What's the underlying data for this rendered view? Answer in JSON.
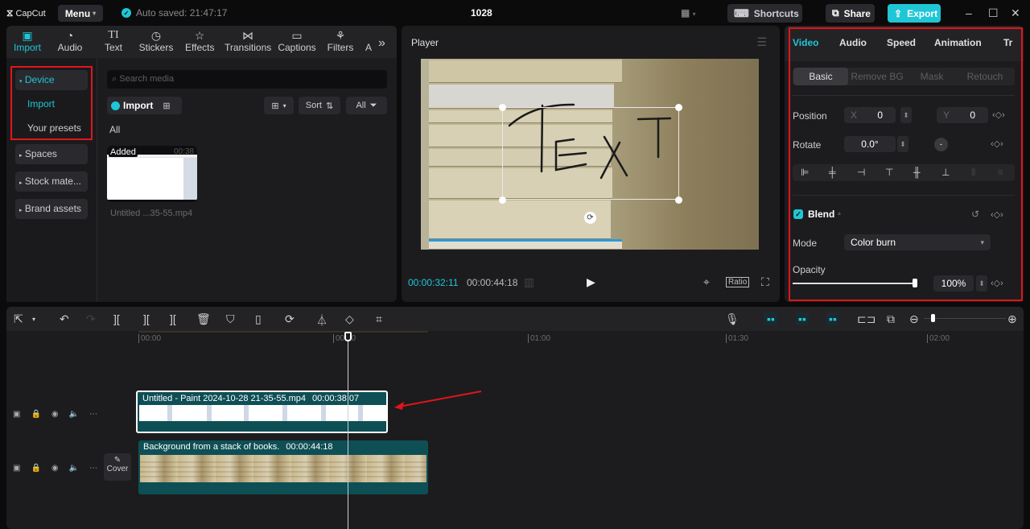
{
  "titlebar": {
    "app_name": "CapCut",
    "menu_label": "Menu",
    "autosave_text": "Auto saved: 21:47:17",
    "project_title": "1028",
    "shortcuts_label": "Shortcuts",
    "share_label": "Share",
    "export_label": "Export",
    "accent_color": "#1fc6d6"
  },
  "media_panel": {
    "tabs": [
      {
        "label": "Import",
        "icon": "import-icon",
        "active": true
      },
      {
        "label": "Audio",
        "icon": "audio-icon"
      },
      {
        "label": "Text",
        "icon": "text-icon"
      },
      {
        "label": "Stickers",
        "icon": "sticker-icon"
      },
      {
        "label": "Effects",
        "icon": "effects-icon"
      },
      {
        "label": "Transitions",
        "icon": "transitions-icon"
      },
      {
        "label": "Captions",
        "icon": "captions-icon"
      },
      {
        "label": "Filters",
        "icon": "filters-icon"
      },
      {
        "label": "A",
        "icon": ""
      }
    ],
    "sidebar": {
      "device": "Device",
      "import": "Import",
      "presets": "Your presets",
      "spaces": "Spaces",
      "stock": "Stock mate...",
      "brand": "Brand assets"
    },
    "search_placeholder": "Search media",
    "import_button": "Import",
    "sort_label": "Sort",
    "filter_label": "All",
    "section_label": "All",
    "items": [
      {
        "badge": "Added",
        "duration": "00:38",
        "name": "Untitled ...35-55.mp4"
      }
    ]
  },
  "player": {
    "title": "Player",
    "current_time": "00:00:32:11",
    "total_time": "00:00:44:18",
    "ratio_label": "Ratio",
    "overlay_text": "TEXT"
  },
  "properties": {
    "tabs": [
      "Video",
      "Audio",
      "Speed",
      "Animation",
      "Tr"
    ],
    "subtabs": [
      "Basic",
      "Remove BG",
      "Mask",
      "Retouch"
    ],
    "position_label": "Position",
    "x_label": "X",
    "x_value": "0",
    "y_label": "Y",
    "y_value": "0",
    "rotate_label": "Rotate",
    "rotate_value": "0.0°",
    "blend_label": "Blend",
    "blend_enabled": true,
    "mode_label": "Mode",
    "mode_value": "Color burn",
    "opacity_label": "Opacity",
    "opacity_value": "100%",
    "opacity_fraction": 1.0
  },
  "timeline": {
    "ruler": [
      "00:00",
      "00:30",
      "01:00",
      "01:30",
      "02:00"
    ],
    "cover_label": "Cover",
    "clips": [
      {
        "name": "Untitled - Paint 2024-10-28 21-35-55.mp4",
        "duration": "00:00:38:07"
      },
      {
        "name": "Background from a stack of books.",
        "duration": "00:00:44:18"
      }
    ]
  }
}
